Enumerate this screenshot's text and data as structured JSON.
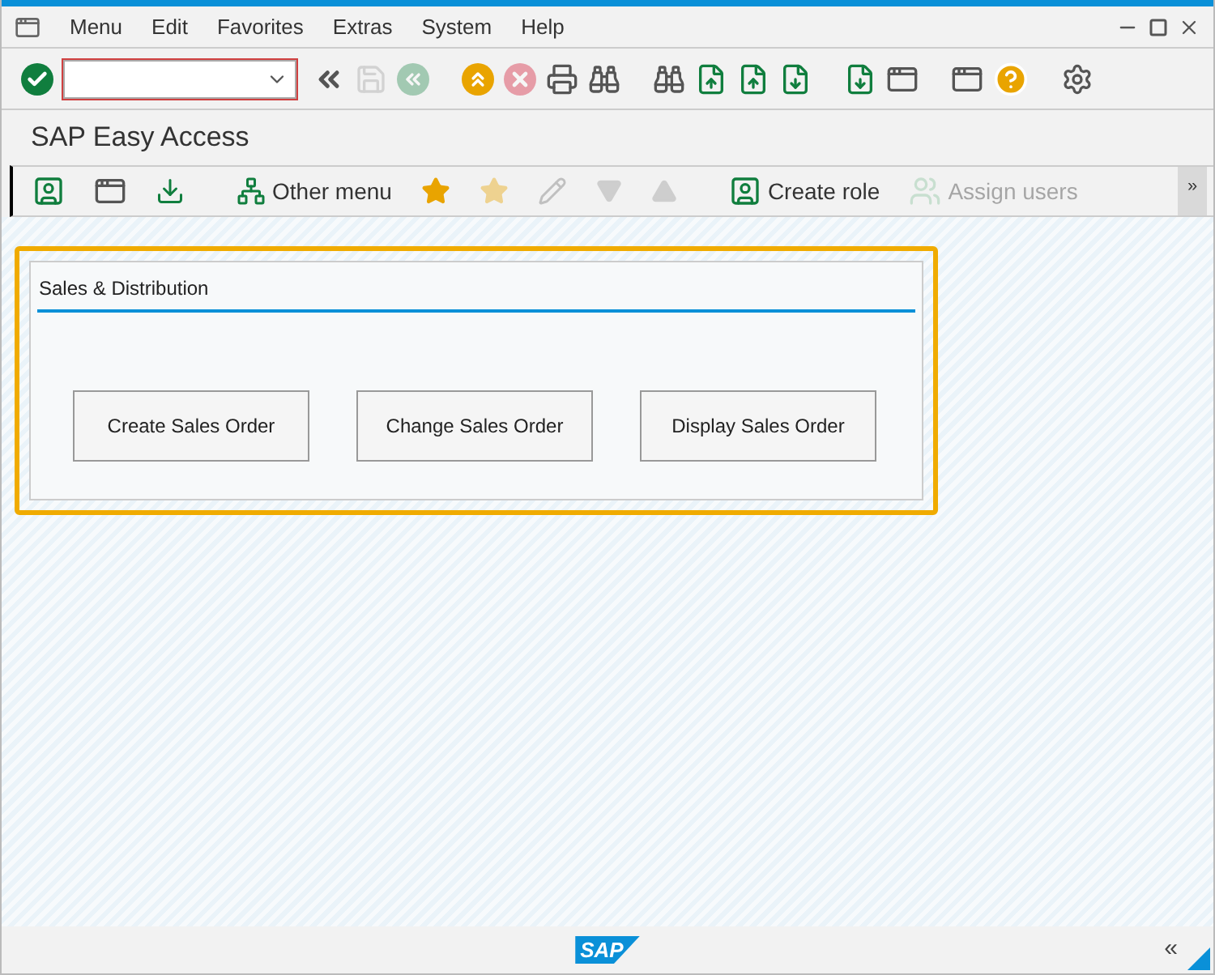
{
  "menu": [
    "Menu",
    "Edit",
    "Favorites",
    "Extras",
    "System",
    "Help"
  ],
  "toolbar": [
    {
      "disabled": false
    },
    {
      "disabled": false
    },
    {
      "disabled": true
    },
    {
      "disabled": true
    },
    {
      "disabled": false
    },
    {
      "disabled": true
    },
    {
      "disabled": false
    },
    {
      "disabled": false
    },
    {
      "disabled": false
    },
    {
      "disabled": false
    },
    {
      "disabled": false
    },
    {
      "disabled": false
    },
    {
      "disabled": false
    },
    {
      "disabled": false
    },
    {
      "disabled": false
    },
    {
      "disabled": false
    },
    {
      "disabled": false
    }
  ],
  "title": "SAP Easy Access",
  "app_toolbar": [
    {
      "disabled": false
    },
    {
      "disabled": false
    },
    {
      "disabled": false
    },
    {
      "label": "Other menu",
      "disabled": false
    },
    {
      "disabled": false
    },
    {
      "disabled": true
    },
    {
      "disabled": true
    },
    {
      "disabled": true
    },
    {
      "disabled": true
    },
    {
      "label": "Create role",
      "disabled": false
    },
    {
      "label": "Assign users",
      "disabled": true
    }
  ],
  "more": "»",
  "group": {
    "title": "Sales & Distribution",
    "buttons": [
      "Create Sales Order",
      "Change Sales Order",
      "Display Sales Order"
    ]
  },
  "footer": {
    "logo": "SAP",
    "collapse": "«"
  }
}
